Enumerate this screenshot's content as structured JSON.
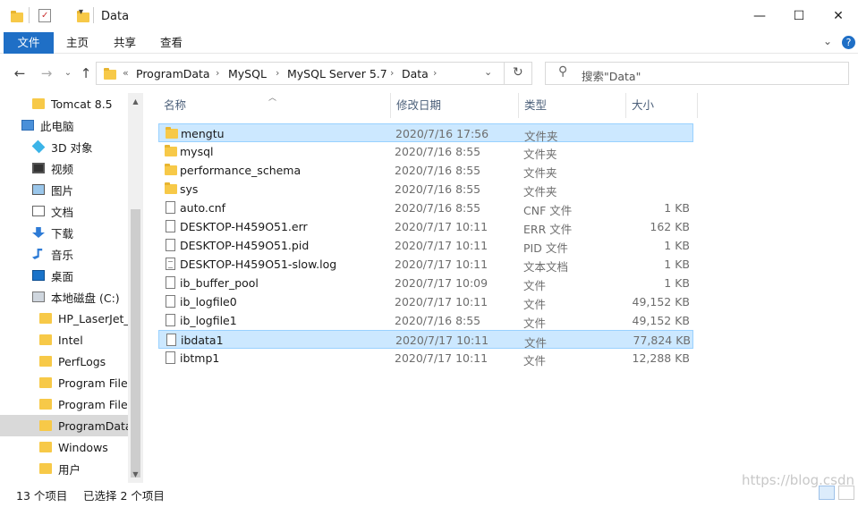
{
  "window": {
    "title": "Data",
    "controls": {
      "minimize": "—",
      "maximize": "☐",
      "close": "✕"
    }
  },
  "ribbon": {
    "tabs": [
      "文件",
      "主页",
      "共享",
      "查看"
    ],
    "expand": "⌄",
    "help": "?"
  },
  "nav": {
    "back": "←",
    "forward": "→",
    "dropdown": "⌄",
    "up": "↑",
    "breadcrumb_prefix": "«",
    "breadcrumb": [
      "ProgramData",
      "MySQL",
      "MySQL Server 5.7",
      "Data"
    ],
    "separator": "›",
    "refresh": "↻",
    "search_placeholder": "搜索\"Data\""
  },
  "sidebar": {
    "items": [
      {
        "label": "Tomcat 8.5",
        "icon": "folder-icon",
        "indent": 1
      },
      {
        "label": "此电脑",
        "icon": "computer-icon",
        "indent": 0
      },
      {
        "label": "3D 对象",
        "icon": "3d-objects-icon",
        "indent": 1
      },
      {
        "label": "视频",
        "icon": "video-icon",
        "indent": 1
      },
      {
        "label": "图片",
        "icon": "pictures-icon",
        "indent": 1
      },
      {
        "label": "文档",
        "icon": "documents-icon",
        "indent": 1
      },
      {
        "label": "下载",
        "icon": "download-icon",
        "indent": 1
      },
      {
        "label": "音乐",
        "icon": "music-icon",
        "indent": 1
      },
      {
        "label": "桌面",
        "icon": "desktop-icon",
        "indent": 1
      },
      {
        "label": "本地磁盘 (C:)",
        "icon": "drive-icon",
        "indent": 1
      },
      {
        "label": "HP_LaserJet_E",
        "icon": "folder-icon",
        "indent": 2
      },
      {
        "label": "Intel",
        "icon": "folder-icon",
        "indent": 2
      },
      {
        "label": "PerfLogs",
        "icon": "folder-icon",
        "indent": 2
      },
      {
        "label": "Program Files",
        "icon": "folder-icon",
        "indent": 2
      },
      {
        "label": "Program Files",
        "icon": "folder-icon",
        "indent": 2
      },
      {
        "label": "ProgramData",
        "icon": "folder-icon",
        "indent": 2,
        "selected": true
      },
      {
        "label": "Windows",
        "icon": "folder-icon",
        "indent": 2
      },
      {
        "label": "用户",
        "icon": "folder-icon",
        "indent": 2
      }
    ]
  },
  "columns": {
    "name": "名称",
    "date": "修改日期",
    "type": "类型",
    "size": "大小"
  },
  "files": [
    {
      "name": "mengtu",
      "date": "2020/7/16 17:56",
      "type": "文件夹",
      "size": "",
      "icon": "folder-icon",
      "selected": true
    },
    {
      "name": "mysql",
      "date": "2020/7/16 8:55",
      "type": "文件夹",
      "size": "",
      "icon": "folder-icon"
    },
    {
      "name": "performance_schema",
      "date": "2020/7/16 8:55",
      "type": "文件夹",
      "size": "",
      "icon": "folder-icon"
    },
    {
      "name": "sys",
      "date": "2020/7/16 8:55",
      "type": "文件夹",
      "size": "",
      "icon": "folder-icon"
    },
    {
      "name": "auto.cnf",
      "date": "2020/7/16 8:55",
      "type": "CNF 文件",
      "size": "1 KB",
      "icon": "file-icon"
    },
    {
      "name": "DESKTOP-H459O51.err",
      "date": "2020/7/17 10:11",
      "type": "ERR 文件",
      "size": "162 KB",
      "icon": "file-icon"
    },
    {
      "name": "DESKTOP-H459O51.pid",
      "date": "2020/7/17 10:11",
      "type": "PID 文件",
      "size": "1 KB",
      "icon": "file-icon"
    },
    {
      "name": "DESKTOP-H459O51-slow.log",
      "date": "2020/7/17 10:11",
      "type": "文本文档",
      "size": "1 KB",
      "icon": "text-file-icon"
    },
    {
      "name": "ib_buffer_pool",
      "date": "2020/7/17 10:09",
      "type": "文件",
      "size": "1 KB",
      "icon": "file-icon"
    },
    {
      "name": "ib_logfile0",
      "date": "2020/7/17 10:11",
      "type": "文件",
      "size": "49,152 KB",
      "icon": "file-icon"
    },
    {
      "name": "ib_logfile1",
      "date": "2020/7/16 8:55",
      "type": "文件",
      "size": "49,152 KB",
      "icon": "file-icon"
    },
    {
      "name": "ibdata1",
      "date": "2020/7/17 10:11",
      "type": "文件",
      "size": "77,824 KB",
      "icon": "file-icon",
      "selected": true
    },
    {
      "name": "ibtmp1",
      "date": "2020/7/17 10:11",
      "type": "文件",
      "size": "12,288 KB",
      "icon": "file-icon"
    }
  ],
  "status": {
    "count": "13 个项目",
    "selected": "已选择 2 个项目"
  },
  "watermark": "https://blog.csdn",
  "colors": {
    "accent": "#1f6fc6",
    "selection": "#cce8ff",
    "folder": "#f7c948"
  }
}
